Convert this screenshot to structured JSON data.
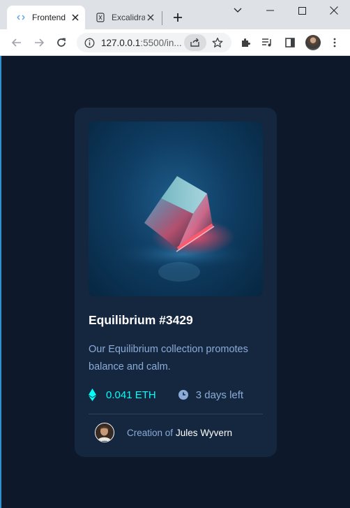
{
  "browser": {
    "tabs": [
      {
        "title": "Frontend",
        "active": true
      },
      {
        "title": "Excalidraw",
        "active": false
      }
    ],
    "url": {
      "host": "127.0.0.1",
      "rest": ":5500/in..."
    }
  },
  "card": {
    "title": "Equilibrium #3429",
    "description": "Our Equilibrium collection promotes balance and calm.",
    "price": "0.041 ETH",
    "time_left": "3 days left",
    "creator_prefix": "Creation of",
    "creator_name": "Jules Wyvern"
  },
  "colors": {
    "page_bg": "#0d192b",
    "card_bg": "#15263f",
    "cyan": "#00fff8",
    "soft_blue": "#8bacd9",
    "white": "#ffffff"
  },
  "icons": [
    "frontend-favicon-icon",
    "excalidraw-favicon-icon",
    "close-icon",
    "plus-icon",
    "chevron-down-icon",
    "minimize-icon",
    "maximize-icon",
    "window-close-icon",
    "back-icon",
    "forward-icon",
    "reload-icon",
    "info-icon",
    "share-icon",
    "star-icon",
    "puzzle-icon",
    "media-icon",
    "side-panel-icon",
    "kebab-menu-icon",
    "ethereum-icon",
    "clock-icon"
  ]
}
